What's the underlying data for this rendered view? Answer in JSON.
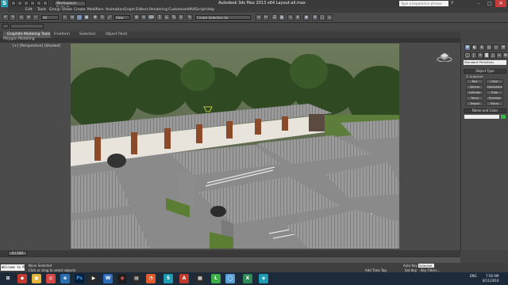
{
  "titlebar": {
    "workspace": "Workspace: Default",
    "title": "Autodesk 3ds Max  2013 x64     Layout-all.max",
    "search_placeholder": "Type a keyword or phrase"
  },
  "menu": [
    "Edit",
    "Tools",
    "Group",
    "Views",
    "Create",
    "Modifiers",
    "Animation",
    "Graph Editors",
    "Rendering",
    "Customize",
    "MAXScript",
    "Help"
  ],
  "toolbar": {
    "selection_filter": "All",
    "ref_coord": "View",
    "selection_set": "Create Selection Se"
  },
  "ribbon": {
    "tabs": [
      "Graphite Modeling Tools",
      "Freeform",
      "Selection",
      "Object Paint"
    ],
    "sub": "Polygon Modeling"
  },
  "viewport": {
    "label": "[+] [Perspective] [Shaded]"
  },
  "command_panel": {
    "category": "Standard Primitives",
    "object_type_title": "Object Type",
    "autogrid": "AutoGrid",
    "buttons": [
      "Box",
      "Cone",
      "Sphere",
      "GeoSphere",
      "Cylinder",
      "Tube",
      "Torus",
      "Pyramid",
      "Teapot",
      "Plane"
    ],
    "name_color_title": "Name and Color",
    "accent": "#39b54a"
  },
  "timeline": {
    "frame": "0 / 100"
  },
  "status": {
    "selected": "None Selected",
    "prompt": "Click or drag to select objects",
    "welcome": "Welcome to M",
    "add_time_tag": "Add Time Tag",
    "auto_key": "Auto Key",
    "selected_dd": "Selected",
    "set_key": "Set Key",
    "key_filters": "Key Filters..."
  },
  "taskbar": {
    "time": "7:56 AM",
    "date": "8/11/2016",
    "lang": "ENG"
  }
}
